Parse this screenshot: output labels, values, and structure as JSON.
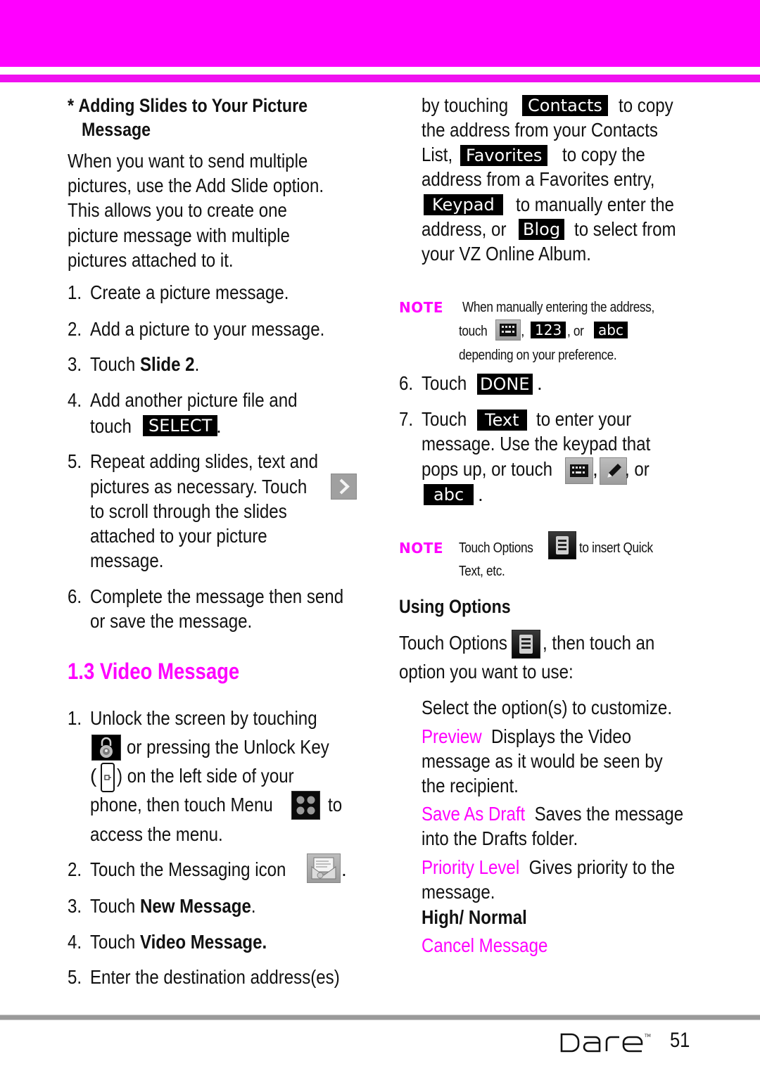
{
  "colors": {
    "accent": "#ff00ff",
    "text": "#111111",
    "key_bg": "#000000",
    "key_fg": "#ffffff",
    "rule": "#9a9a9a"
  },
  "left": {
    "subheading_bullet": "*",
    "subheading_line1": "Adding Slides to Your Picture",
    "subheading_line2": "Message",
    "intro": [
      "When you want to send multiple",
      "pictures, use the Add Slide option.",
      "This allows you to create one",
      "picture message with multiple",
      "pictures attached to it."
    ],
    "steps": {
      "s1": {
        "num": "1.",
        "text": "Create a picture message."
      },
      "s2": {
        "num": "2.",
        "text": "Add a picture to your message."
      },
      "s3": {
        "num": "3.",
        "pre": "Touch ",
        "bold": "Slide 2",
        "post": "."
      },
      "s4": {
        "num": "4.",
        "line1": "Add another picture file and",
        "pre": "touch ",
        "key": "SELECT",
        "post": "."
      },
      "s5": {
        "num": "5.",
        "line1": "Repeat adding slides, text and",
        "line2": "pictures as necessary. Touch",
        "line3": "to scroll through the slides",
        "line4": "attached to your picture",
        "line5": "message."
      },
      "s6": {
        "num": "6.",
        "line1": "Complete the message then send",
        "line2": "or save the message."
      }
    },
    "section_title": "1.3 Video Message",
    "video_steps": {
      "v1": {
        "num": "1.",
        "line1": "Unlock the screen by touching",
        "line2": "or pressing the Unlock Key",
        "line3_pre": "(",
        "line3_post": ") on the left side of your",
        "line4_pre": "phone, then touch Menu",
        "line4_post": "to",
        "line5": "access the menu."
      },
      "v2": {
        "num": "2.",
        "text": "Touch the Messaging icon",
        "post": "."
      },
      "v3": {
        "num": "3.",
        "pre": "Touch ",
        "bold": "New Message",
        "post": "."
      },
      "v4": {
        "num": "4.",
        "pre": "Touch ",
        "bold": "Video Message."
      },
      "v5": {
        "num": "5.",
        "text": "Enter the destination address(es)"
      }
    }
  },
  "right": {
    "cont": {
      "l1_pre": "by touching",
      "l1_key": "Contacts",
      "l1_post": "to copy",
      "l2": "the address from your Contacts",
      "l3_pre": "List,",
      "l3_key": "Favorites",
      "l3_post": "to copy the",
      "l4": "address from a Favorites entry,",
      "l5_key": "Keypad",
      "l5_post": "to manually enter the",
      "l6_pre": "address, or",
      "l6_key": "Blog",
      "l6_post": "to select from",
      "l7": "your VZ Online Album."
    },
    "note1": {
      "label": "NOTE",
      "line1": "When manually entering the address,",
      "line2_pre": "touch",
      "key_123": "123",
      "or": ", or",
      "key_abc": "abc",
      "line3": "depending on your preference."
    },
    "s6": {
      "num": "6.",
      "pre": "Touch",
      "key": "DONE",
      "post": "."
    },
    "s7": {
      "num": "7.",
      "pre": "Touch",
      "key": "Text",
      "post": "to enter your",
      "line2": "message. Use the keypad that",
      "line3_pre": "pops up, or touch",
      "or": ", or",
      "key2": "abc",
      "post2": "."
    },
    "note2": {
      "label": "NOTE",
      "pre": "Touch Options",
      "post": "to insert Quick",
      "line2": "Text, etc."
    },
    "using_options": {
      "heading": "Using Options",
      "intro_pre": "Touch Options",
      "intro_post": ", then touch an",
      "intro_line2": "option you want to use:",
      "select_line": "Select the option(s) to customize.",
      "options": [
        {
          "name": "Preview",
          "desc1": "Displays the Video",
          "desc2": "message as it would be seen by",
          "desc3": "the recipient."
        },
        {
          "name": "Save As Draft",
          "desc1": "Saves the message",
          "desc2": "into the Drafts folder."
        },
        {
          "name": "Priority Level",
          "desc1": "Gives priority to the",
          "desc2": "message.",
          "values": "High/ Normal"
        },
        {
          "name": "Cancel Message"
        }
      ]
    }
  },
  "footer": {
    "brand": "Dare",
    "trademark": "™",
    "page_number": "51"
  },
  "icons": {
    "next_arrow": "chevron-right-icon",
    "unlock": "padlock-icon",
    "unlock_key": "unlock-key-icon",
    "menu": "menu-grid-icon",
    "messaging": "envelope-icon",
    "keyboard": "keyboard-icon",
    "pen": "pencil-icon",
    "options": "options-list-icon"
  }
}
